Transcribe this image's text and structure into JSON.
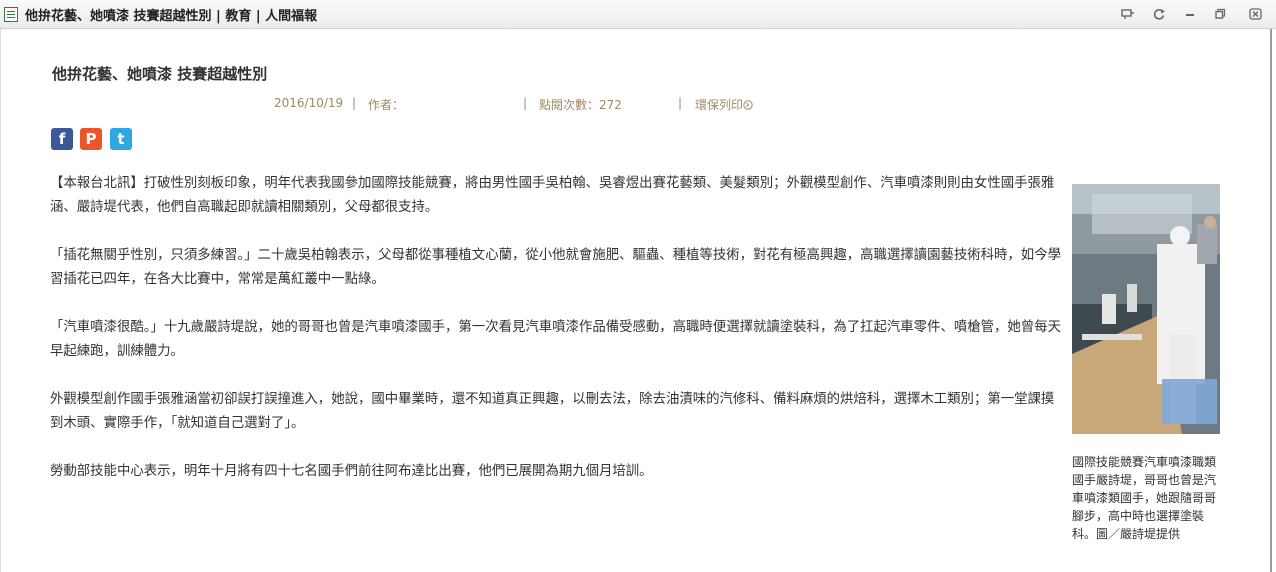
{
  "window": {
    "title": "他拚花藝、她噴漆 技賽超越性別 | 教育 | 人間福報",
    "buttons": [
      "pin",
      "refresh",
      "minimize",
      "restore",
      "close"
    ]
  },
  "article": {
    "title": "他拚花藝、她噴漆 技賽超越性別",
    "date": "2016/10/19",
    "author_label": "作者：",
    "views_label": "點閱次數：272",
    "print_label": "環保列印",
    "share": [
      {
        "name": "facebook",
        "glyph": "f",
        "color": "#3b5998"
      },
      {
        "name": "plurk",
        "glyph": "P",
        "color": "#e8562a"
      },
      {
        "name": "twitter",
        "glyph": "t",
        "color": "#2fa7e0"
      }
    ],
    "paragraphs": [
      "【本報台北訊】打破性別刻板印象，明年代表我國參加國際技能競賽，將由男性國手吳柏翰、吳睿煜出賽花藝類、美髮類別；外觀模型創作、汽車噴漆則則由女性國手張雅涵、嚴詩堤代表，他們自高職起即就讀相關類別，父母都很支持。",
      "「插花無關乎性別，只須多練習。」二十歲吳柏翰表示，父母都從事種植文心蘭，從小他就會施肥、驅蟲、種植等技術，對花有極高興趣，高職選擇讀園藝技術科時，如今學習插花已四年，在各大比賽中，常常是萬紅叢中一點綠。",
      "「汽車噴漆很酷。」十九歲嚴詩堤說，她的哥哥也曾是汽車噴漆國手，第一次看見汽車噴漆作品備受感動，高職時便選擇就讀塗裝科，為了扛起汽車零件、噴槍管，她曾每天早起練跑，訓練體力。",
      "外觀模型創作國手張雅涵當初卻誤打誤撞進入，她說，國中畢業時，還不知道真正興趣，以刪去法，除去油漬味的汽修科、備料麻煩的烘焙科，選擇木工類別；第一堂課摸到木頭、實際手作，「就知道自己選對了」。",
      "勞動部技能中心表示，明年十月將有四十七名國手們前往阿布達比出賽，他們已展開為期九個月培訓。"
    ],
    "photo_caption": "國際技能競賽汽車噴漆職類國手嚴詩堤，哥哥也曾是汽車噴漆類國手，她跟隨哥哥腳步，高中時也選擇塗裝科。圖／嚴詩堤提供"
  }
}
